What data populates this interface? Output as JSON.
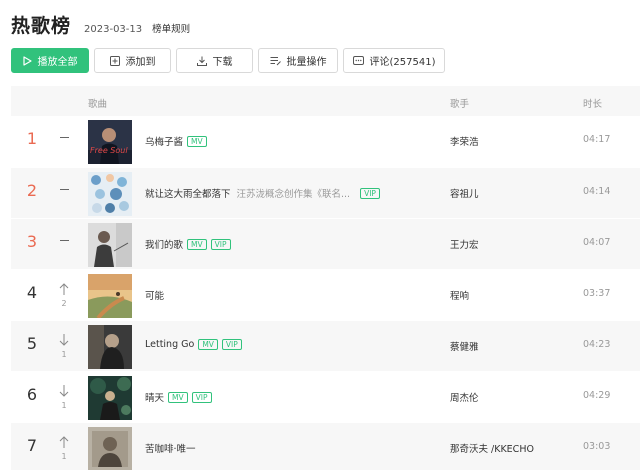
{
  "header": {
    "title": "热歌榜",
    "date": "2023-03-13",
    "rule_link": "榜单规则"
  },
  "toolbar": {
    "play_all": "播放全部",
    "add_to": "添加到",
    "download": "下载",
    "batch": "批量操作",
    "comment": "评论(257541)"
  },
  "table": {
    "col_song": "歌曲",
    "col_singer": "歌手",
    "col_duration": "时长",
    "rows": [
      {
        "rank": "1",
        "trend": "flat",
        "trend_num": "",
        "title": "乌梅子酱",
        "subtitle": "",
        "tags": [
          "MV"
        ],
        "singer": "李荣浩",
        "duration": "04:17"
      },
      {
        "rank": "2",
        "trend": "flat",
        "trend_num": "",
        "title": "就让这大雨全都落下",
        "subtitle": "汪苏泷概念创作集《联名...",
        "tags": [
          "VIP"
        ],
        "singer": "容祖儿",
        "duration": "04:14"
      },
      {
        "rank": "3",
        "trend": "flat",
        "trend_num": "",
        "title": "我们的歌",
        "subtitle": "",
        "tags": [
          "MV",
          "VIP"
        ],
        "singer": "王力宏",
        "duration": "04:07"
      },
      {
        "rank": "4",
        "trend": "up",
        "trend_num": "2",
        "title": "可能",
        "subtitle": "",
        "tags": [],
        "singer": "程响",
        "duration": "03:37"
      },
      {
        "rank": "5",
        "trend": "down",
        "trend_num": "1",
        "title": "Letting Go",
        "subtitle": "",
        "tags": [
          "MV",
          "VIP"
        ],
        "singer": "蔡健雅",
        "duration": "04:23"
      },
      {
        "rank": "6",
        "trend": "down",
        "trend_num": "1",
        "title": "晴天",
        "subtitle": "",
        "tags": [
          "MV",
          "VIP"
        ],
        "singer": "周杰伦",
        "duration": "04:29"
      },
      {
        "rank": "7",
        "trend": "up",
        "trend_num": "1",
        "title": "苦咖啡·唯一",
        "subtitle": "",
        "tags": [],
        "singer": "那奇沃夫 /KKECHO",
        "duration": "03:03"
      }
    ]
  },
  "cover_art_text": {
    "row1": "Free Soul"
  },
  "colors": {
    "accent": "#31c27c",
    "top_rank": "#ea6a52"
  }
}
